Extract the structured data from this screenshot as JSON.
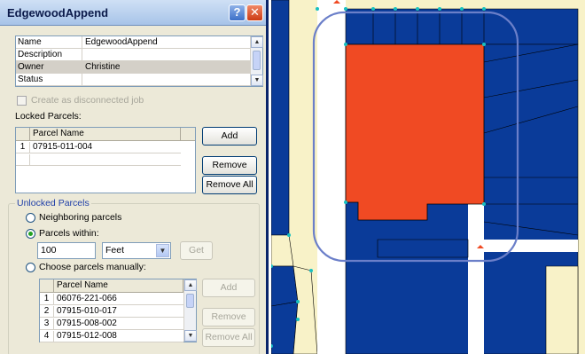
{
  "window": {
    "title": "EdgewoodAppend",
    "help_glyph": "?",
    "close_glyph": "✕"
  },
  "properties": [
    {
      "key": "Name",
      "value": "EdgewoodAppend"
    },
    {
      "key": "Description",
      "value": ""
    },
    {
      "key": "Owner",
      "value": "Christine"
    },
    {
      "key": "Status",
      "value": ""
    }
  ],
  "disconnected_checkbox": {
    "label": "Create as disconnected job",
    "checked": false,
    "enabled": false
  },
  "locked_parcels": {
    "label": "Locked Parcels:",
    "column_header": "Parcel Name",
    "rows": [
      {
        "num": "1",
        "name": "07915-011-004"
      }
    ],
    "add_label": "Add",
    "remove_label": "Remove",
    "remove_all_label": "Remove All"
  },
  "unlocked_parcels": {
    "group_label": "Unlocked Parcels",
    "neighboring_label": "Neighboring parcels",
    "within_label": "Parcels within:",
    "within_value": "100",
    "units_value": "Feet",
    "get_label": "Get",
    "manual_label": "Choose parcels manually:",
    "column_header": "Parcel Name",
    "rows": [
      {
        "num": "1",
        "name": "06076-221-066"
      },
      {
        "num": "2",
        "name": "07915-010-017"
      },
      {
        "num": "3",
        "name": "07915-008-002"
      },
      {
        "num": "4",
        "name": "07915-012-008"
      }
    ],
    "add_label": "Add",
    "remove_label": "Remove",
    "remove_all_label": "Remove All",
    "selected_option": "Parcels within:"
  },
  "colors": {
    "parcel_fill": "#0a3b99",
    "selected_parcel": "#f04a23",
    "road_fill": "#f8f2c8",
    "selection_outline": "#6b7fc9",
    "vertex": "#17c0c0"
  }
}
